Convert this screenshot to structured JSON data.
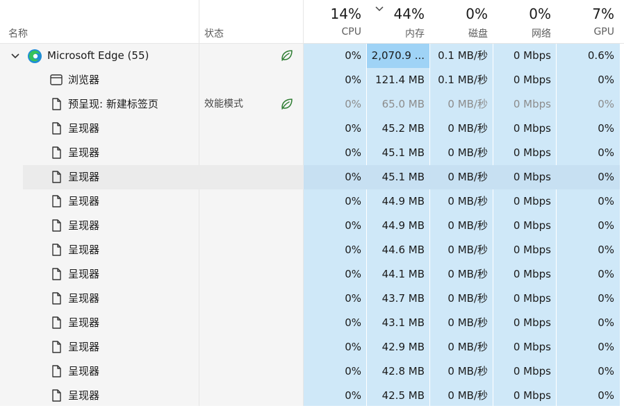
{
  "header": {
    "name_label": "名称",
    "status_label": "状态",
    "cpu": {
      "pct": "14%",
      "label": "CPU"
    },
    "mem": {
      "pct": "44%",
      "label": "内存"
    },
    "disk": {
      "pct": "0%",
      "label": "磁盘"
    },
    "net": {
      "pct": "0%",
      "label": "网络"
    },
    "gpu": {
      "pct": "7%",
      "label": "GPU"
    }
  },
  "rows": [
    {
      "name": "Microsoft Edge (55)",
      "status": "",
      "cpu": "0%",
      "mem": "2,070.9 ...",
      "disk": "0.1 MB/秒",
      "net": "0 Mbps",
      "gpu": "0.6%"
    },
    {
      "name": "浏览器",
      "status": "",
      "cpu": "0%",
      "mem": "121.4 MB",
      "disk": "0.1 MB/秒",
      "net": "0 Mbps",
      "gpu": "0%"
    },
    {
      "name": "预呈现: 新建标签页",
      "status": "效能模式",
      "cpu": "0%",
      "mem": "65.0 MB",
      "disk": "0 MB/秒",
      "net": "0 Mbps",
      "gpu": "0%"
    },
    {
      "name": "呈现器",
      "status": "",
      "cpu": "0%",
      "mem": "45.2 MB",
      "disk": "0 MB/秒",
      "net": "0 Mbps",
      "gpu": "0%"
    },
    {
      "name": "呈现器",
      "status": "",
      "cpu": "0%",
      "mem": "45.1 MB",
      "disk": "0 MB/秒",
      "net": "0 Mbps",
      "gpu": "0%"
    },
    {
      "name": "呈现器",
      "status": "",
      "cpu": "0%",
      "mem": "45.1 MB",
      "disk": "0 MB/秒",
      "net": "0 Mbps",
      "gpu": "0%"
    },
    {
      "name": "呈现器",
      "status": "",
      "cpu": "0%",
      "mem": "44.9 MB",
      "disk": "0 MB/秒",
      "net": "0 Mbps",
      "gpu": "0%"
    },
    {
      "name": "呈现器",
      "status": "",
      "cpu": "0%",
      "mem": "44.9 MB",
      "disk": "0 MB/秒",
      "net": "0 Mbps",
      "gpu": "0%"
    },
    {
      "name": "呈现器",
      "status": "",
      "cpu": "0%",
      "mem": "44.6 MB",
      "disk": "0 MB/秒",
      "net": "0 Mbps",
      "gpu": "0%"
    },
    {
      "name": "呈现器",
      "status": "",
      "cpu": "0%",
      "mem": "44.1 MB",
      "disk": "0 MB/秒",
      "net": "0 Mbps",
      "gpu": "0%"
    },
    {
      "name": "呈现器",
      "status": "",
      "cpu": "0%",
      "mem": "43.7 MB",
      "disk": "0 MB/秒",
      "net": "0 Mbps",
      "gpu": "0%"
    },
    {
      "name": "呈现器",
      "status": "",
      "cpu": "0%",
      "mem": "43.1 MB",
      "disk": "0 MB/秒",
      "net": "0 Mbps",
      "gpu": "0%"
    },
    {
      "name": "呈现器",
      "status": "",
      "cpu": "0%",
      "mem": "42.9 MB",
      "disk": "0 MB/秒",
      "net": "0 Mbps",
      "gpu": "0%"
    },
    {
      "name": "呈现器",
      "status": "",
      "cpu": "0%",
      "mem": "42.8 MB",
      "disk": "0 MB/秒",
      "net": "0 Mbps",
      "gpu": "0%"
    },
    {
      "name": "呈现器",
      "status": "",
      "cpu": "0%",
      "mem": "42.5 MB",
      "disk": "0 MB/秒",
      "net": "0 Mbps",
      "gpu": "0%"
    }
  ],
  "colors": {
    "metric_bg": "#cfe8f8",
    "metric_bg_hover": "#c3ddef",
    "mem_highlight": "#9fd3f6",
    "name_bg": "#f5f5f5",
    "hover_bg": "#ebebeb",
    "leaf_green": "#2e7d32"
  }
}
